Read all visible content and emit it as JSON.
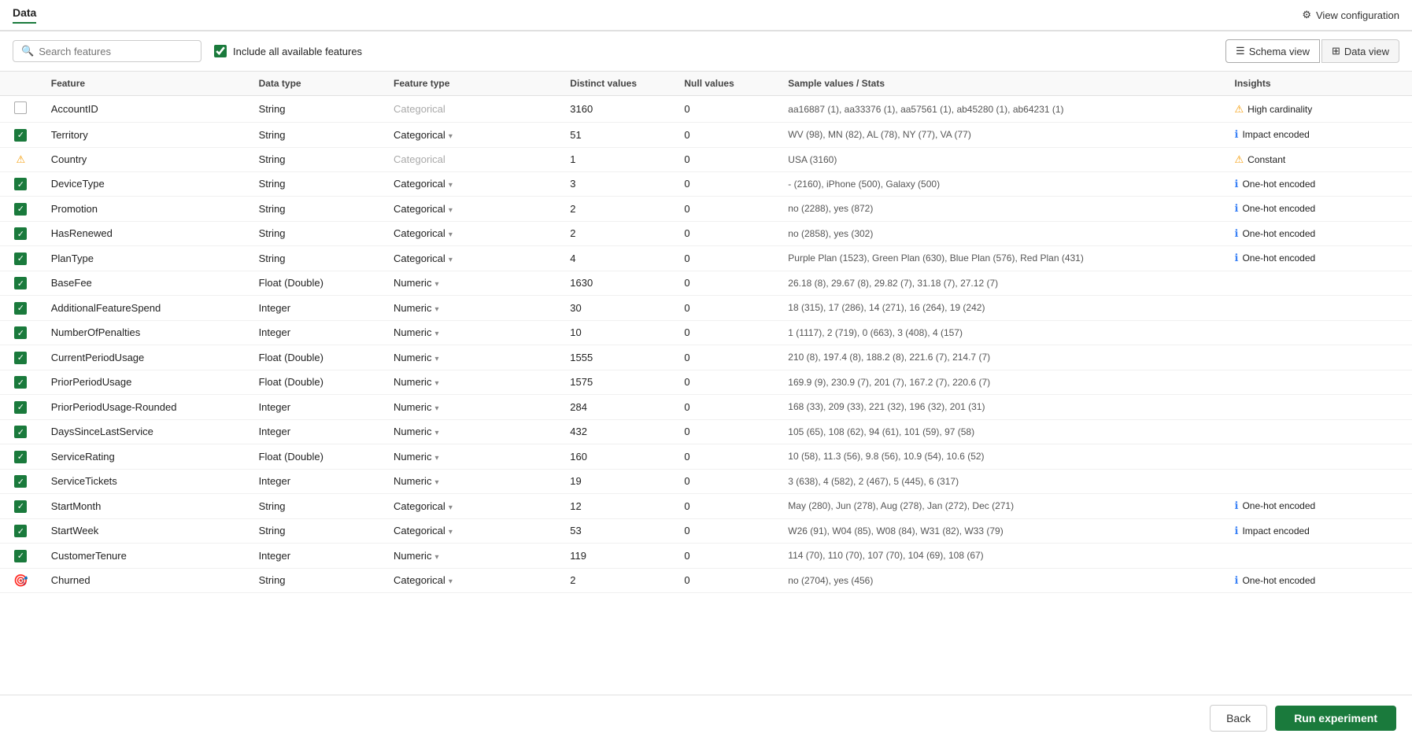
{
  "topBar": {
    "tab": "Data",
    "viewConfigLabel": "View configuration"
  },
  "toolbar": {
    "searchPlaceholder": "Search features",
    "includeAllLabel": "Include all available features",
    "schemaViewLabel": "Schema view",
    "dataViewLabel": "Data view"
  },
  "columns": {
    "feature": "Feature",
    "dataType": "Data type",
    "featureType": "Feature type",
    "distinctValues": "Distinct values",
    "nullValues": "Null values",
    "sampleValues": "Sample values / Stats",
    "insights": "Insights"
  },
  "rows": [
    {
      "id": "AccountID",
      "checkState": "unchecked",
      "dataType": "String",
      "featureType": "Categorical",
      "featureTypeActive": false,
      "distinctValues": "3160",
      "nullValues": "0",
      "sample": "aa16887 (1), aa33376 (1), aa57561 (1), ab45280 (1), ab64231 (1)",
      "insightIcon": "warn",
      "insightText": "High cardinality"
    },
    {
      "id": "Territory",
      "checkState": "checked",
      "dataType": "String",
      "featureType": "Categorical",
      "featureTypeActive": true,
      "distinctValues": "51",
      "nullValues": "0",
      "sample": "WV (98), MN (82), AL (78), NY (77), VA (77)",
      "insightIcon": "info",
      "insightText": "Impact encoded"
    },
    {
      "id": "Country",
      "checkState": "warning",
      "dataType": "String",
      "featureType": "Categorical",
      "featureTypeActive": false,
      "distinctValues": "1",
      "nullValues": "0",
      "sample": "USA (3160)",
      "insightIcon": "warn",
      "insightText": "Constant"
    },
    {
      "id": "DeviceType",
      "checkState": "checked",
      "dataType": "String",
      "featureType": "Categorical",
      "featureTypeActive": true,
      "distinctValues": "3",
      "nullValues": "0",
      "sample": "- (2160), iPhone (500), Galaxy (500)",
      "insightIcon": "info",
      "insightText": "One-hot encoded"
    },
    {
      "id": "Promotion",
      "checkState": "checked",
      "dataType": "String",
      "featureType": "Categorical",
      "featureTypeActive": true,
      "distinctValues": "2",
      "nullValues": "0",
      "sample": "no (2288), yes (872)",
      "insightIcon": "info",
      "insightText": "One-hot encoded"
    },
    {
      "id": "HasRenewed",
      "checkState": "checked",
      "dataType": "String",
      "featureType": "Categorical",
      "featureTypeActive": true,
      "distinctValues": "2",
      "nullValues": "0",
      "sample": "no (2858), yes (302)",
      "insightIcon": "info",
      "insightText": "One-hot encoded"
    },
    {
      "id": "PlanType",
      "checkState": "checked",
      "dataType": "String",
      "featureType": "Categorical",
      "featureTypeActive": true,
      "distinctValues": "4",
      "nullValues": "0",
      "sample": "Purple Plan (1523), Green Plan (630), Blue Plan (576), Red Plan (431)",
      "insightIcon": "info",
      "insightText": "One-hot encoded"
    },
    {
      "id": "BaseFee",
      "checkState": "checked",
      "dataType": "Float (Double)",
      "featureType": "Numeric",
      "featureTypeActive": true,
      "distinctValues": "1630",
      "nullValues": "0",
      "sample": "26.18 (8), 29.67 (8), 29.82 (7), 31.18 (7), 27.12 (7)",
      "insightIcon": null,
      "insightText": ""
    },
    {
      "id": "AdditionalFeatureSpend",
      "checkState": "checked",
      "dataType": "Integer",
      "featureType": "Numeric",
      "featureTypeActive": true,
      "distinctValues": "30",
      "nullValues": "0",
      "sample": "18 (315), 17 (286), 14 (271), 16 (264), 19 (242)",
      "insightIcon": null,
      "insightText": ""
    },
    {
      "id": "NumberOfPenalties",
      "checkState": "checked",
      "dataType": "Integer",
      "featureType": "Numeric",
      "featureTypeActive": true,
      "distinctValues": "10",
      "nullValues": "0",
      "sample": "1 (1117), 2 (719), 0 (663), 3 (408), 4 (157)",
      "insightIcon": null,
      "insightText": ""
    },
    {
      "id": "CurrentPeriodUsage",
      "checkState": "checked",
      "dataType": "Float (Double)",
      "featureType": "Numeric",
      "featureTypeActive": true,
      "distinctValues": "1555",
      "nullValues": "0",
      "sample": "210 (8), 197.4 (8), 188.2 (8), 221.6 (7), 214.7 (7)",
      "insightIcon": null,
      "insightText": ""
    },
    {
      "id": "PriorPeriodUsage",
      "checkState": "checked",
      "dataType": "Float (Double)",
      "featureType": "Numeric",
      "featureTypeActive": true,
      "distinctValues": "1575",
      "nullValues": "0",
      "sample": "169.9 (9), 230.9 (7), 201 (7), 167.2 (7), 220.6 (7)",
      "insightIcon": null,
      "insightText": ""
    },
    {
      "id": "PriorPeriodUsage-Rounded",
      "checkState": "checked",
      "dataType": "Integer",
      "featureType": "Numeric",
      "featureTypeActive": true,
      "distinctValues": "284",
      "nullValues": "0",
      "sample": "168 (33), 209 (33), 221 (32), 196 (32), 201 (31)",
      "insightIcon": null,
      "insightText": ""
    },
    {
      "id": "DaysSinceLastService",
      "checkState": "checked",
      "dataType": "Integer",
      "featureType": "Numeric",
      "featureTypeActive": true,
      "distinctValues": "432",
      "nullValues": "0",
      "sample": "105 (65), 108 (62), 94 (61), 101 (59), 97 (58)",
      "insightIcon": null,
      "insightText": ""
    },
    {
      "id": "ServiceRating",
      "checkState": "checked",
      "dataType": "Float (Double)",
      "featureType": "Numeric",
      "featureTypeActive": true,
      "distinctValues": "160",
      "nullValues": "0",
      "sample": "10 (58), 11.3 (56), 9.8 (56), 10.9 (54), 10.6 (52)",
      "insightIcon": null,
      "insightText": ""
    },
    {
      "id": "ServiceTickets",
      "checkState": "checked",
      "dataType": "Integer",
      "featureType": "Numeric",
      "featureTypeActive": true,
      "distinctValues": "19",
      "nullValues": "0",
      "sample": "3 (638), 4 (582), 2 (467), 5 (445), 6 (317)",
      "insightIcon": null,
      "insightText": ""
    },
    {
      "id": "StartMonth",
      "checkState": "checked",
      "dataType": "String",
      "featureType": "Categorical",
      "featureTypeActive": true,
      "distinctValues": "12",
      "nullValues": "0",
      "sample": "May (280), Jun (278), Aug (278), Jan (272), Dec (271)",
      "insightIcon": "info",
      "insightText": "One-hot encoded"
    },
    {
      "id": "StartWeek",
      "checkState": "checked",
      "dataType": "String",
      "featureType": "Categorical",
      "featureTypeActive": true,
      "distinctValues": "53",
      "nullValues": "0",
      "sample": "W26 (91), W04 (85), W08 (84), W31 (82), W33 (79)",
      "insightIcon": "info",
      "insightText": "Impact encoded"
    },
    {
      "id": "CustomerTenure",
      "checkState": "checked",
      "dataType": "Integer",
      "featureType": "Numeric",
      "featureTypeActive": true,
      "distinctValues": "119",
      "nullValues": "0",
      "sample": "114 (70), 110 (70), 107 (70), 104 (69), 108 (67)",
      "insightIcon": null,
      "insightText": ""
    },
    {
      "id": "Churned",
      "checkState": "target",
      "dataType": "String",
      "featureType": "Categorical",
      "featureTypeActive": true,
      "distinctValues": "2",
      "nullValues": "0",
      "sample": "no (2704), yes (456)",
      "insightIcon": "info",
      "insightText": "One-hot encoded"
    }
  ],
  "footer": {
    "backLabel": "Back",
    "runLabel": "Run experiment"
  }
}
